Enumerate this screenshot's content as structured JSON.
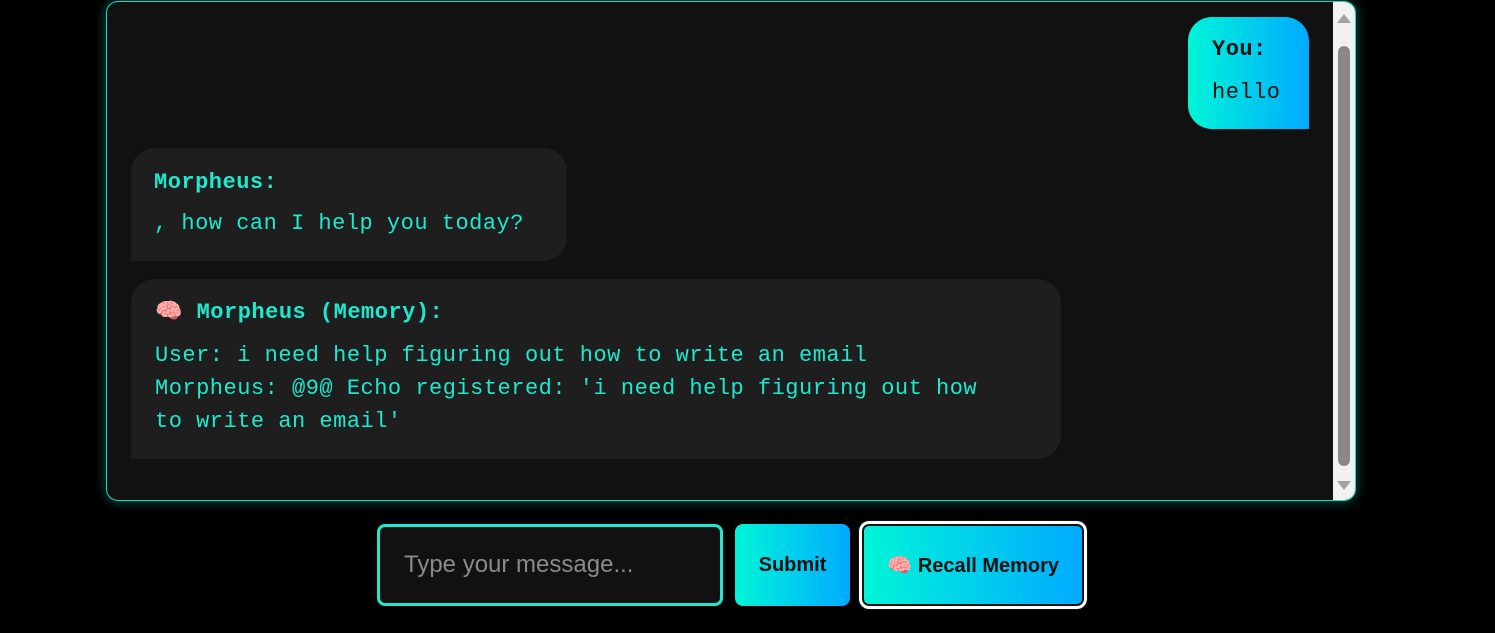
{
  "chat": {
    "messages": [
      {
        "sender": "You:",
        "text": "hello"
      },
      {
        "sender": "Morpheus:",
        "text": ", how can I help you today?"
      },
      {
        "icon": "brain-icon",
        "sender": "Morpheus (Memory):",
        "text": "User: i need help figuring out how to write an email\nMorpheus: @9@ Echo registered: 'i need help figuring out how\nto write an email'"
      }
    ]
  },
  "composer": {
    "placeholder": "Type your message...",
    "submit_label": "Submit",
    "recall_label": "Recall Memory",
    "recall_icon": "brain-icon"
  },
  "colors": {
    "accent_teal": "#1de9cf",
    "gradient_start": "#00f5d8",
    "gradient_end": "#00aaff",
    "background": "#000000",
    "panel": "#111111",
    "bubble": "#1e1e1e"
  }
}
